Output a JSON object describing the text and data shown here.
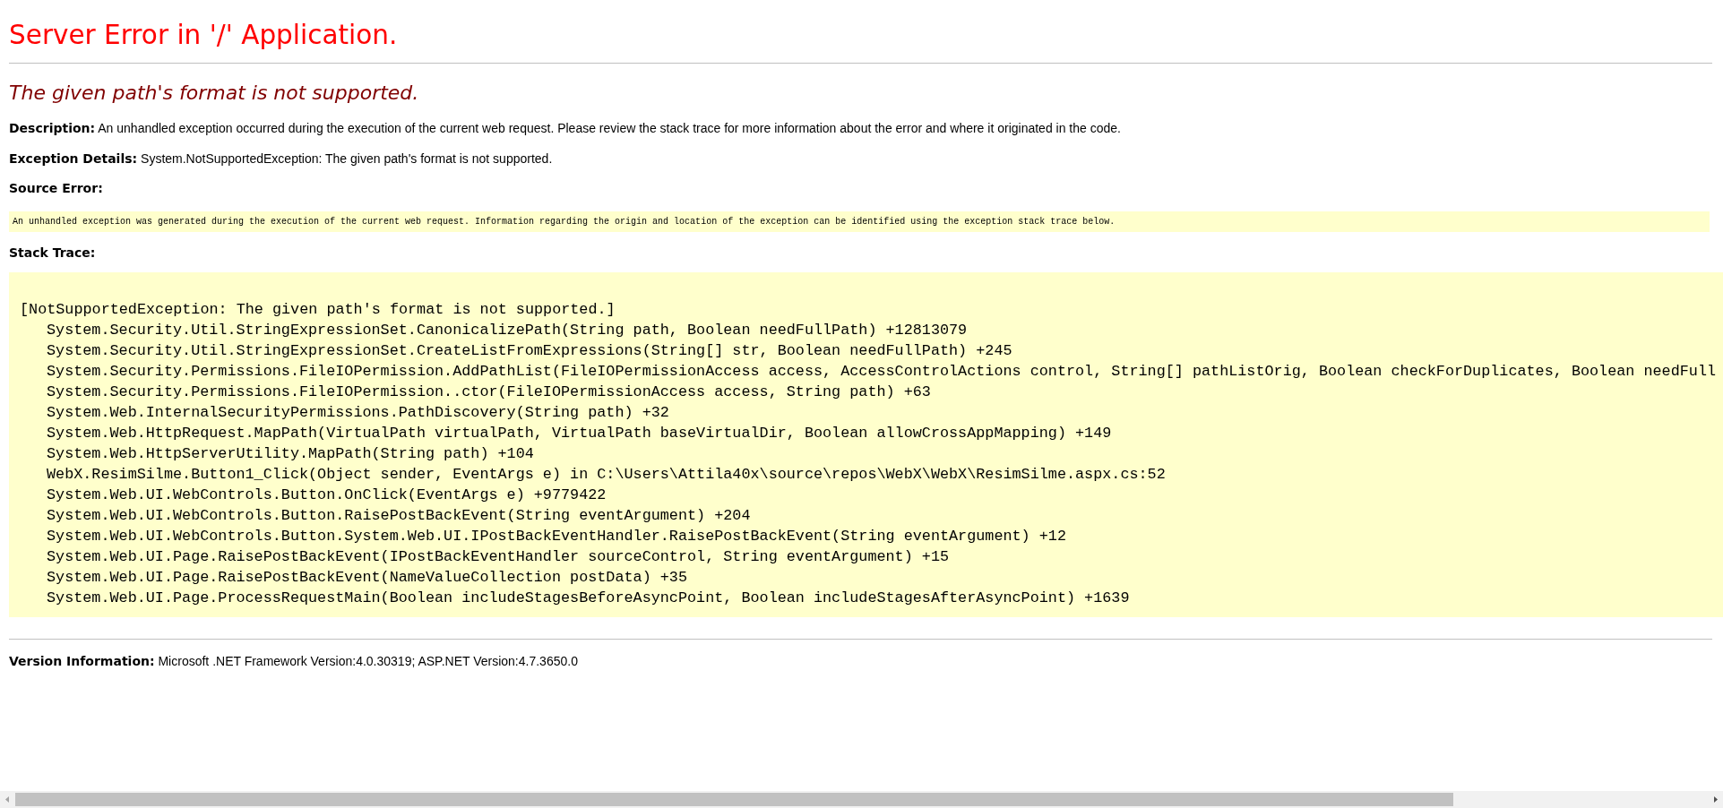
{
  "title": "Server Error in '/' Application.",
  "error_heading": "The given path's format is not supported.",
  "description": {
    "label": "Description:",
    "text": "An unhandled exception occurred during the execution of the current web request. Please review the stack trace for more information about the error and where it originated in the code."
  },
  "exception_details": {
    "label": "Exception Details:",
    "text": "System.NotSupportedException: The given path's format is not supported."
  },
  "source_error": {
    "label": "Source Error:",
    "text": "An unhandled exception was generated during the execution of the current web request. Information regarding the origin and location of the exception can be identified using the exception stack trace below."
  },
  "stack_trace": {
    "label": "Stack Trace:",
    "exception": "[NotSupportedException: The given path's format is not supported.]",
    "frames": [
      "System.Security.Util.StringExpressionSet.CanonicalizePath(String path, Boolean needFullPath) +12813079",
      "System.Security.Util.StringExpressionSet.CreateListFromExpressions(String[] str, Boolean needFullPath) +245",
      "System.Security.Permissions.FileIOPermission.AddPathList(FileIOPermissionAccess access, AccessControlActions control, String[] pathListOrig, Boolean checkForDuplicates, Boolean needFull",
      "System.Security.Permissions.FileIOPermission..ctor(FileIOPermissionAccess access, String path) +63",
      "System.Web.InternalSecurityPermissions.PathDiscovery(String path) +32",
      "System.Web.HttpRequest.MapPath(VirtualPath virtualPath, VirtualPath baseVirtualDir, Boolean allowCrossAppMapping) +149",
      "System.Web.HttpServerUtility.MapPath(String path) +104",
      "WebX.ResimSilme.Button1_Click(Object sender, EventArgs e) in C:\\Users\\Attila40x\\source\\repos\\WebX\\WebX\\ResimSilme.aspx.cs:52",
      "System.Web.UI.WebControls.Button.OnClick(EventArgs e) +9779422",
      "System.Web.UI.WebControls.Button.RaisePostBackEvent(String eventArgument) +204",
      "System.Web.UI.WebControls.Button.System.Web.UI.IPostBackEventHandler.RaisePostBackEvent(String eventArgument) +12",
      "System.Web.UI.Page.RaisePostBackEvent(IPostBackEventHandler sourceControl, String eventArgument) +15",
      "System.Web.UI.Page.RaisePostBackEvent(NameValueCollection postData) +35",
      "System.Web.UI.Page.ProcessRequestMain(Boolean includeStagesBeforeAsyncPoint, Boolean includeStagesAfterAsyncPoint) +1639"
    ]
  },
  "version": {
    "label": "Version Information:",
    "text": "Microsoft .NET Framework Version:4.0.30319; ASP.NET Version:4.7.3650.0"
  }
}
